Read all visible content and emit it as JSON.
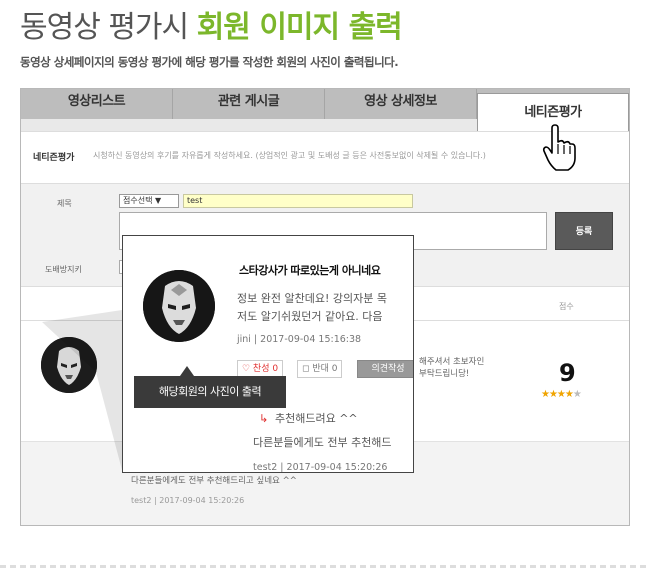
{
  "heading": {
    "plain": "동영상 평가시 ",
    "accent": "회원 이미지 출력"
  },
  "subtitle": "동영상 상세페이지의 동영상 평가에 해당 평가를 작성한 회원의 사진이 출력됩니다.",
  "tabs": [
    {
      "label": "영상리스트"
    },
    {
      "label": "관련 게시글"
    },
    {
      "label": "영상 상세정보"
    },
    {
      "label": "네티즌평가"
    }
  ],
  "notice": {
    "title": "네티즌평가",
    "text": "시청하신 동영상의 후기를 자유롭게 작성하세요. (상업적인 광고 및 도배성 글 등은 사전통보없이 삭제될 수 있습니다.)"
  },
  "form": {
    "title_label": "제목",
    "score_select": "점수선택 ▼",
    "title_value": "test",
    "captcha_label": "도배방지키",
    "submit_label": "등록"
  },
  "list": {
    "score_header": "점수",
    "review": {
      "text1": "해주셔서 초보자인",
      "text2": "부탁드립니당!",
      "score": "9",
      "stars_full": "★★★★",
      "stars_empty": "★"
    },
    "reply": {
      "text": "다른분들에게도 전부 추천해드리고 싶네요 ^^",
      "meta": "test2  |  2017-09-04 15:20:26"
    }
  },
  "popup": {
    "title": "스타강사가 따로있는게 아니네요",
    "body1": "정보 완전 알찬데요! 강의자분 목",
    "body2": "저도 알기쉬웠던거 같아요. 다음",
    "meta": "jini  |  2017-09-04 15:16:38",
    "agree_label": "♡ 찬성 0",
    "oppose_label": "◻ 반대 0",
    "opinion_label": "의견작성",
    "reply_arrow": "↳",
    "reply1": "추천해드려요 ^^",
    "reply2": "다른분들에게도 전부 추천해드",
    "reply_meta": "test2  |  2017-09-04 15:20:26"
  },
  "tooltip": "해당회원의 사진이 출력",
  "colors": {
    "accent": "#7cb72b",
    "star": "#f0a400",
    "agree": "#e03030"
  }
}
